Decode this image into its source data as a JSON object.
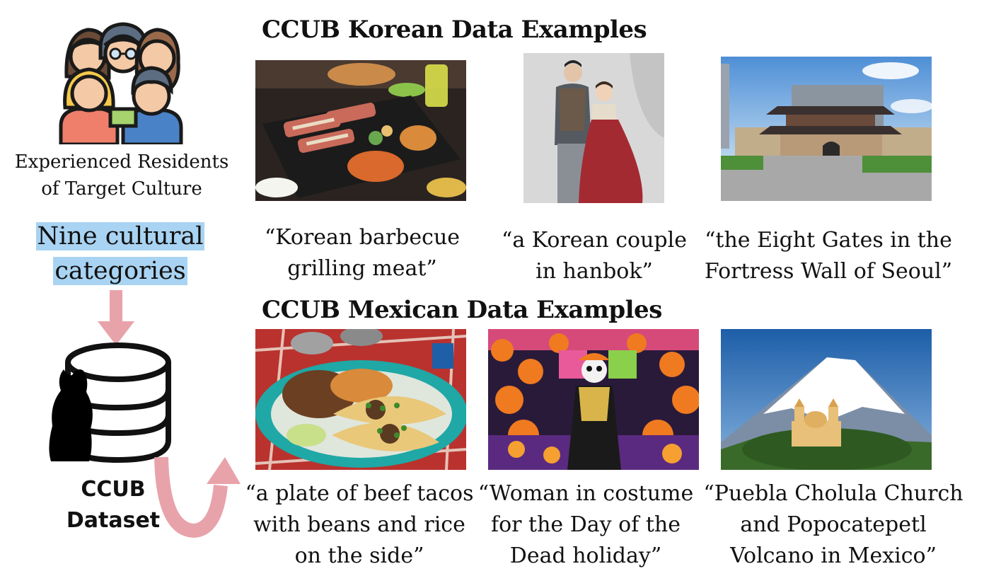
{
  "left_panel": {
    "residents_icon": "group-of-people-icon",
    "residents_label": "Experienced Residents\nof Target Culture",
    "categories_line1": "Nine cultural",
    "categories_line2": "categories",
    "highlight_color": "#a9d3f2",
    "arrow_color": "#e8a3aa",
    "database_icon": "database-with-silhouette-icon",
    "dataset_label": "CCUB\nDataset"
  },
  "korean_section": {
    "heading": "CCUB Korean Data Examples",
    "examples": [
      {
        "image": "korean-bbq-photo",
        "caption": "“Korean barbecue\ngrilling meat”"
      },
      {
        "image": "hanbok-couple-photo",
        "caption": "“a Korean couple\nin hanbok”"
      },
      {
        "image": "seoul-gate-photo",
        "caption": "“the Eight Gates in the\nFortress Wall of Seoul”"
      }
    ]
  },
  "mexican_section": {
    "heading": "CCUB Mexican Data Examples",
    "examples": [
      {
        "image": "beef-tacos-photo",
        "caption": "“a plate of beef tacos\nwith beans and rice\non the side”"
      },
      {
        "image": "day-of-dead-photo",
        "caption": "“Woman in costume\nfor the Day of the\nDead holiday”"
      },
      {
        "image": "cholula-volcano-photo",
        "caption": "“Puebla Cholula Church\nand Popocatepetl\nVolcano in Mexico”"
      }
    ]
  }
}
